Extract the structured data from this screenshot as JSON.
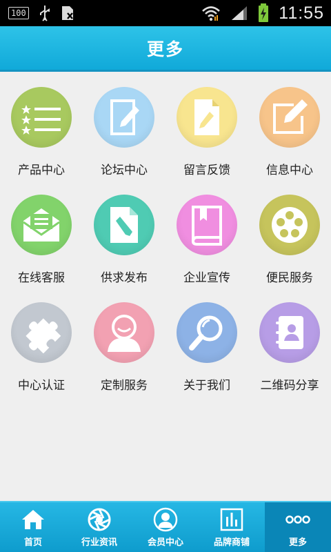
{
  "status_bar": {
    "battery_box": "100",
    "time": "11:55",
    "icons": [
      "battery-level-icon",
      "usb-icon",
      "sim-icon",
      "wifi-icon",
      "signal-icon",
      "charging-battery-icon"
    ]
  },
  "header": {
    "title": "更多"
  },
  "grid": {
    "items": [
      {
        "label": "产品中心",
        "icon": "star-list-icon",
        "color": "#a8c95f"
      },
      {
        "label": "论坛中心",
        "icon": "note-pencil-icon",
        "color": "#a9d7f5"
      },
      {
        "label": "留言反馈",
        "icon": "document-pencil-icon",
        "color": "#f8e58f"
      },
      {
        "label": "信息中心",
        "icon": "edit-box-icon",
        "color": "#f7c48a"
      },
      {
        "label": "在线客服",
        "icon": "envelope-icon",
        "color": "#82d36b"
      },
      {
        "label": "供求发布",
        "icon": "page-pencil-icon",
        "color": "#4fcbb3"
      },
      {
        "label": "企业宣传",
        "icon": "book-icon",
        "color": "#f08ee0"
      },
      {
        "label": "便民服务",
        "icon": "film-reel-icon",
        "color": "#c6c45c"
      },
      {
        "label": "中心认证",
        "icon": "puzzle-icon",
        "color": "#c2c8d0"
      },
      {
        "label": "定制服务",
        "icon": "person-icon",
        "color": "#f2a1b2"
      },
      {
        "label": "关于我们",
        "icon": "magnifier-icon",
        "color": "#8db2e6"
      },
      {
        "label": "二维码分享",
        "icon": "contact-book-icon",
        "color": "#b79de6"
      }
    ]
  },
  "bottom_nav": {
    "items": [
      {
        "label": "首页",
        "icon": "home-icon"
      },
      {
        "label": "行业资讯",
        "icon": "aperture-icon"
      },
      {
        "label": "会员中心",
        "icon": "member-icon"
      },
      {
        "label": "品牌商铺",
        "icon": "chart-bars-icon"
      },
      {
        "label": "更多",
        "icon": "more-dots-icon"
      }
    ],
    "active_index": 4
  }
}
